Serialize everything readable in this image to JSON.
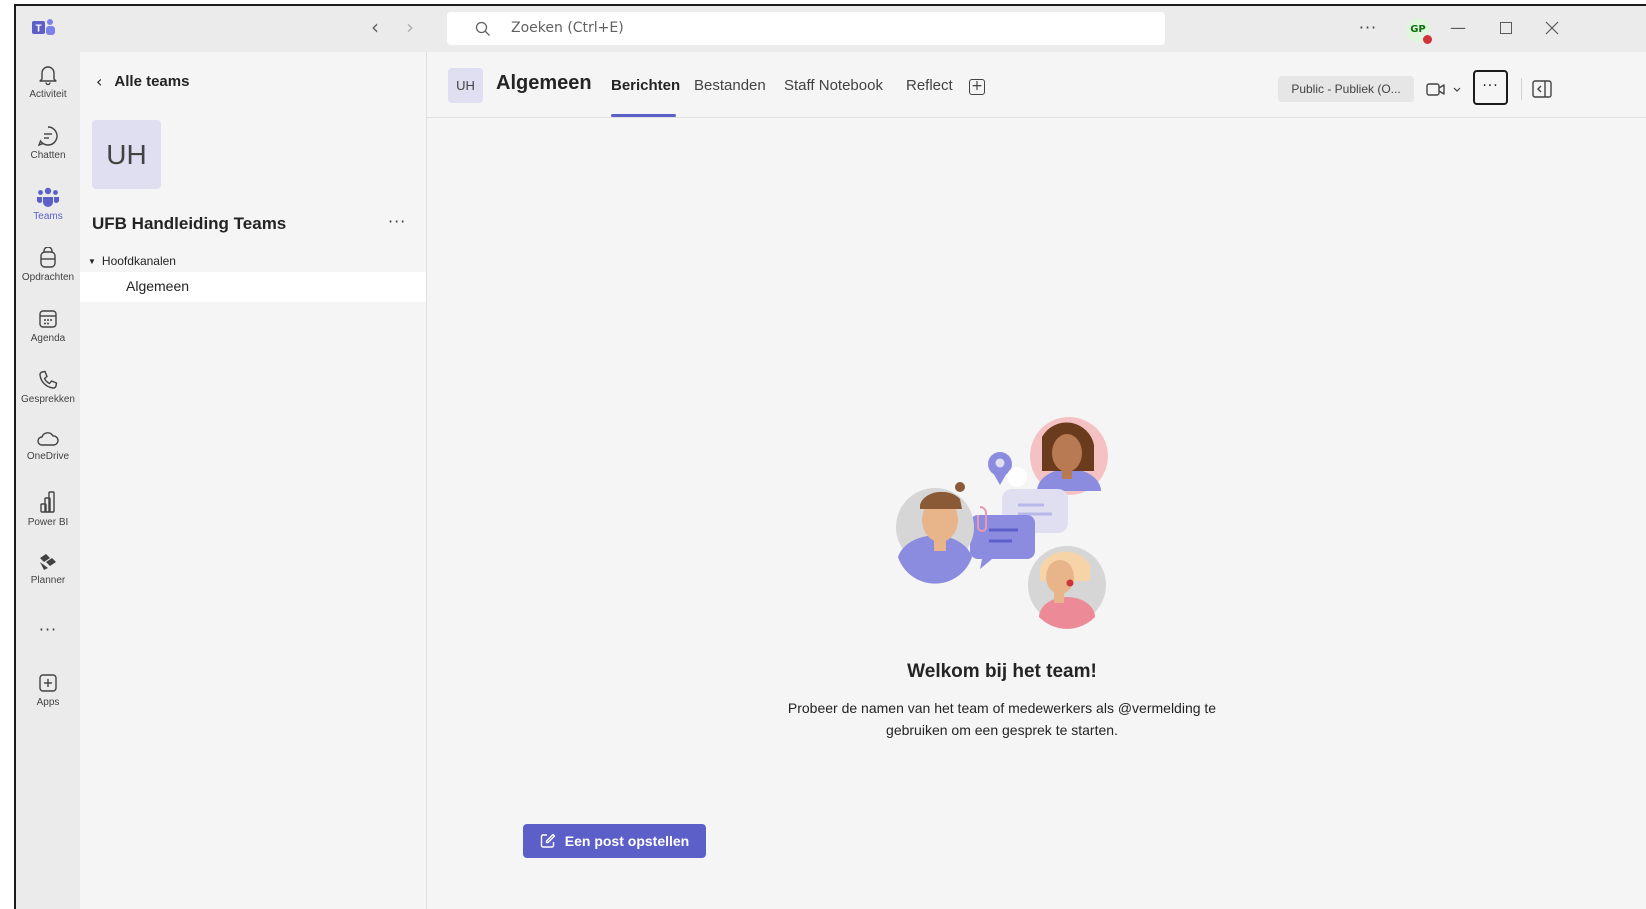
{
  "titlebar": {
    "search_placeholder": "Zoeken (Ctrl+E)",
    "user_initials": "GP",
    "more": "···"
  },
  "rail": {
    "items": [
      {
        "label": "Activiteit",
        "icon": "bell-icon"
      },
      {
        "label": "Chatten",
        "icon": "chat-icon"
      },
      {
        "label": "Teams",
        "icon": "teams-icon"
      },
      {
        "label": "Opdrachten",
        "icon": "assignments-icon"
      },
      {
        "label": "Agenda",
        "icon": "calendar-icon"
      },
      {
        "label": "Gesprekken",
        "icon": "phone-icon"
      },
      {
        "label": "OneDrive",
        "icon": "cloud-icon"
      },
      {
        "label": "Power BI",
        "icon": "powerbi-icon"
      },
      {
        "label": "Planner",
        "icon": "planner-icon"
      },
      {
        "label": "Apps",
        "icon": "add-apps-icon"
      }
    ],
    "more": "···"
  },
  "teampane": {
    "back_label": "Alle teams",
    "team_initials": "UH",
    "team_name": "UFB Handleiding Teams",
    "more": "···",
    "section_label": "Hoofdkanalen",
    "channel_label": "Algemeen"
  },
  "header": {
    "channel_initials": "UH",
    "channel_title": "Algemeen",
    "tabs": [
      "Berichten",
      "Bestanden",
      "Staff Notebook",
      "Reflect"
    ],
    "sensitivity_label": "Public - Publiek (O...",
    "more": "···"
  },
  "welcome": {
    "title": "Welkom bij het team!",
    "text": "Probeer de namen van het team of medewerkers als @vermelding te gebruiken om een gesprek te starten."
  },
  "compose": {
    "label": "Een post opstellen"
  },
  "colors": {
    "accent": "#5b5fc7",
    "presence_busy": "#d13438"
  }
}
